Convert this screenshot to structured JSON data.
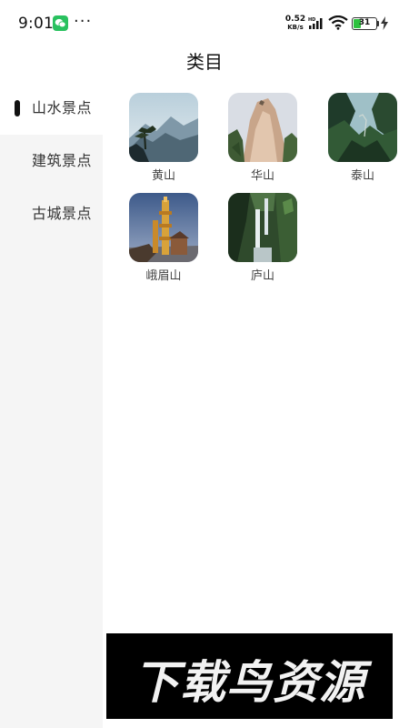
{
  "status_bar": {
    "time": "9:01",
    "more": "···",
    "net_speed_value": "0.52",
    "net_speed_unit": "KB/s",
    "hd": "HD",
    "battery_level": "31",
    "battery_fraction": 0.31,
    "icons": [
      "wechat-icon",
      "signal-icon",
      "wifi-icon",
      "battery-icon",
      "charging-icon"
    ]
  },
  "header": {
    "title": "类目"
  },
  "sidebar": {
    "items": [
      {
        "label": "山水景点",
        "active": true
      },
      {
        "label": "建筑景点",
        "active": false
      },
      {
        "label": "古城景点",
        "active": false
      }
    ]
  },
  "grid": {
    "items": [
      {
        "label": "黄山"
      },
      {
        "label": "华山"
      },
      {
        "label": "泰山"
      },
      {
        "label": "峨眉山"
      },
      {
        "label": "庐山"
      }
    ]
  },
  "watermark": {
    "text": "下载鸟资源"
  },
  "colors": {
    "wechat_green": "#29c15f",
    "battery_green": "#2ec23f",
    "sidebar_bg": "#f5f5f5"
  }
}
